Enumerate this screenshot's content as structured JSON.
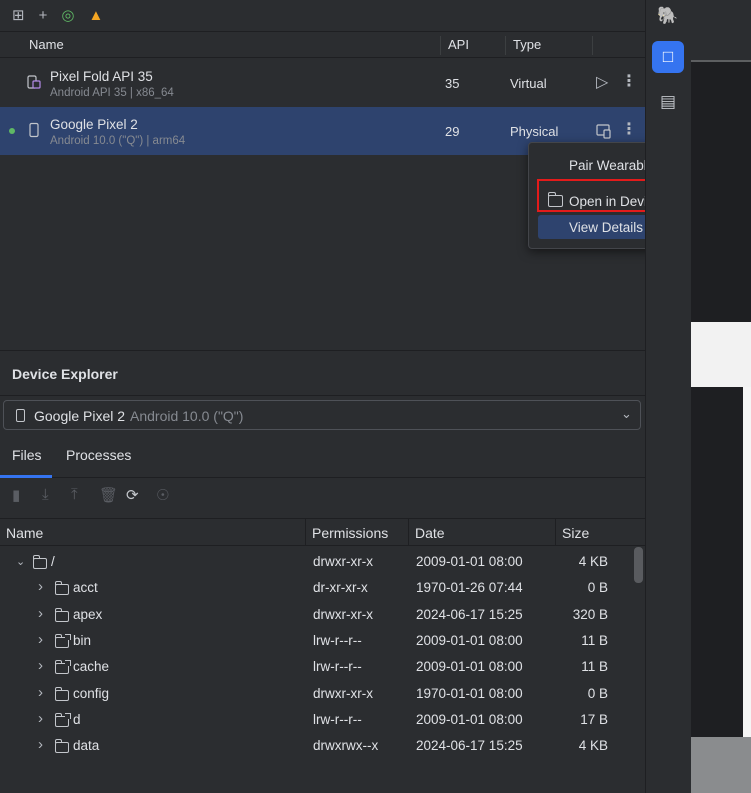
{
  "toolbar": {
    "icons": [
      "device-grid-icon",
      "add-icon",
      "wifi-pairing-icon",
      "firebase-icon"
    ]
  },
  "device_table": {
    "columns": {
      "name": "Name",
      "api": "API",
      "type": "Type"
    },
    "rows": [
      {
        "name": "Pixel Fold API 35",
        "sub": "Android API 35 | x86_64",
        "api": "35",
        "type": "Virtual",
        "action_icon": "play-icon"
      },
      {
        "name": "Google Pixel 2",
        "sub": "Android 10.0 (\"Q\") | arm64",
        "api": "29",
        "type": "Physical",
        "action_icon": "mirror-device-icon"
      }
    ]
  },
  "context_menu": {
    "items": [
      {
        "label": "Pair Wearable"
      },
      {
        "label": "Open in Device Explorer",
        "icon": "folder-icon"
      },
      {
        "label": "View Details"
      }
    ]
  },
  "device_explorer": {
    "title": "Device Explorer",
    "selected_device": {
      "name": "Google Pixel 2",
      "version": "Android 10.0 (\"Q\")"
    },
    "tabs": {
      "files": "Files",
      "processes": "Processes"
    },
    "columns": {
      "name": "Name",
      "permissions": "Permissions",
      "date": "Date",
      "size": "Size"
    },
    "files": [
      {
        "name": "/",
        "perm": "drwxr-xr-x",
        "date": "2009-01-01 08:00",
        "size": "4 KB",
        "expanded": true
      },
      {
        "name": "acct",
        "perm": "dr-xr-xr-x",
        "date": "1970-01-26 07:44",
        "size": "0 B"
      },
      {
        "name": "apex",
        "perm": "drwxr-xr-x",
        "date": "2024-06-17 15:25",
        "size": "320 B"
      },
      {
        "name": "bin",
        "perm": "lrw-r--r--",
        "date": "2009-01-01 08:00",
        "size": "11 B",
        "link": true
      },
      {
        "name": "cache",
        "perm": "lrw-r--r--",
        "date": "2009-01-01 08:00",
        "size": "11 B",
        "link": true
      },
      {
        "name": "config",
        "perm": "drwxr-xr-x",
        "date": "1970-01-01 08:00",
        "size": "0 B"
      },
      {
        "name": "d",
        "perm": "lrw-r--r--",
        "date": "2009-01-01 08:00",
        "size": "17 B",
        "link": true
      },
      {
        "name": "data",
        "perm": "drwxrwx--x",
        "date": "2024-06-17 15:25",
        "size": "4 KB"
      }
    ]
  },
  "colors": {
    "selection": "#2e436e",
    "accent": "#3574f0",
    "highlight_box": "#e31b1b",
    "online": "#5fb865"
  }
}
